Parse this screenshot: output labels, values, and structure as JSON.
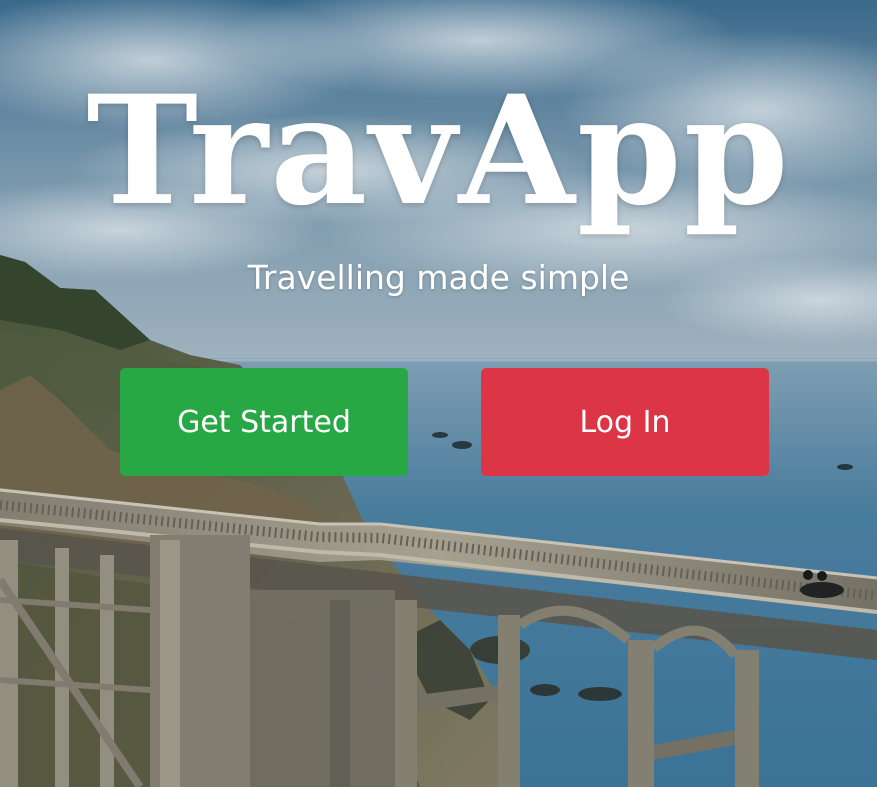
{
  "app": {
    "title": "TravApp",
    "subtitle": "Travelling made simple"
  },
  "actions": {
    "get_started": {
      "label": "Get Started",
      "color": "#28a745"
    },
    "log_in": {
      "label": "Log In",
      "color": "#dc3545"
    }
  },
  "colors": {
    "text": "#ffffff",
    "sky": "#5f8dac",
    "sea": "#4b7ea0"
  }
}
